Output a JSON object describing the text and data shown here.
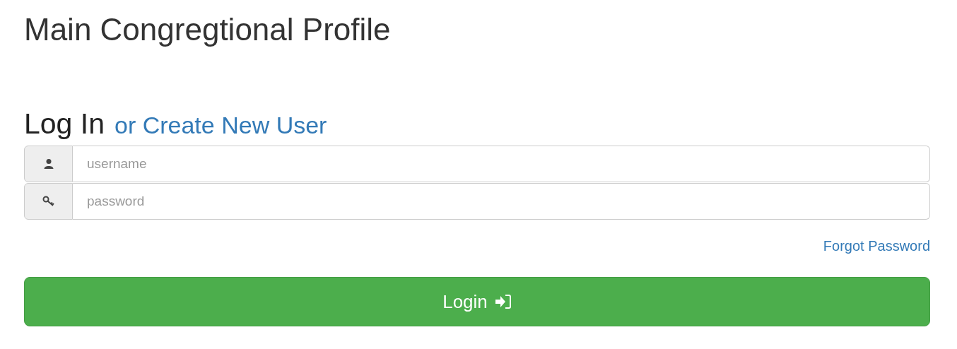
{
  "page_title": "Main Congregtional Profile",
  "heading": {
    "title": "Log In",
    "link": "or Create New User"
  },
  "fields": [
    {
      "kind": "user",
      "placeholder": "username"
    },
    {
      "kind": "key",
      "placeholder": "password"
    }
  ],
  "forgot_link": "Forgot Password",
  "login_button": "Login"
}
